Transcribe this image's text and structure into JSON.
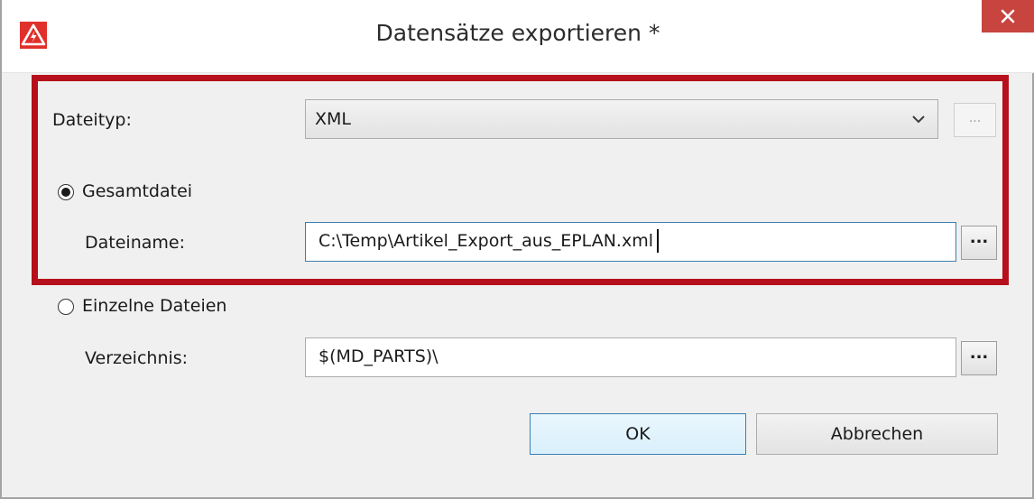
{
  "window": {
    "title": "Datensätze exportieren *"
  },
  "icons": {
    "app": "eplan-warning-icon",
    "close": "close-icon",
    "dropdown": "chevron-down-icon"
  },
  "colors": {
    "highlight_border": "#b5101b",
    "close_button": "#c7443f",
    "app_icon": "#e0302b"
  },
  "form": {
    "filetype": {
      "label": "Dateityp:",
      "value": "XML",
      "settings_label": "..."
    },
    "combined_file": {
      "label": "Gesamtdatei",
      "selected": true,
      "filename_label": "Dateiname:",
      "filename_value": "C:\\Temp\\Artikel_Export_aus_EPLAN.xml",
      "browse_label": "..."
    },
    "single_files": {
      "label": "Einzelne Dateien",
      "selected": false,
      "directory_label": "Verzeichnis:",
      "directory_value": "$(MD_PARTS)\\",
      "browse_label": "..."
    }
  },
  "buttons": {
    "ok": "OK",
    "cancel": "Abbrechen"
  }
}
